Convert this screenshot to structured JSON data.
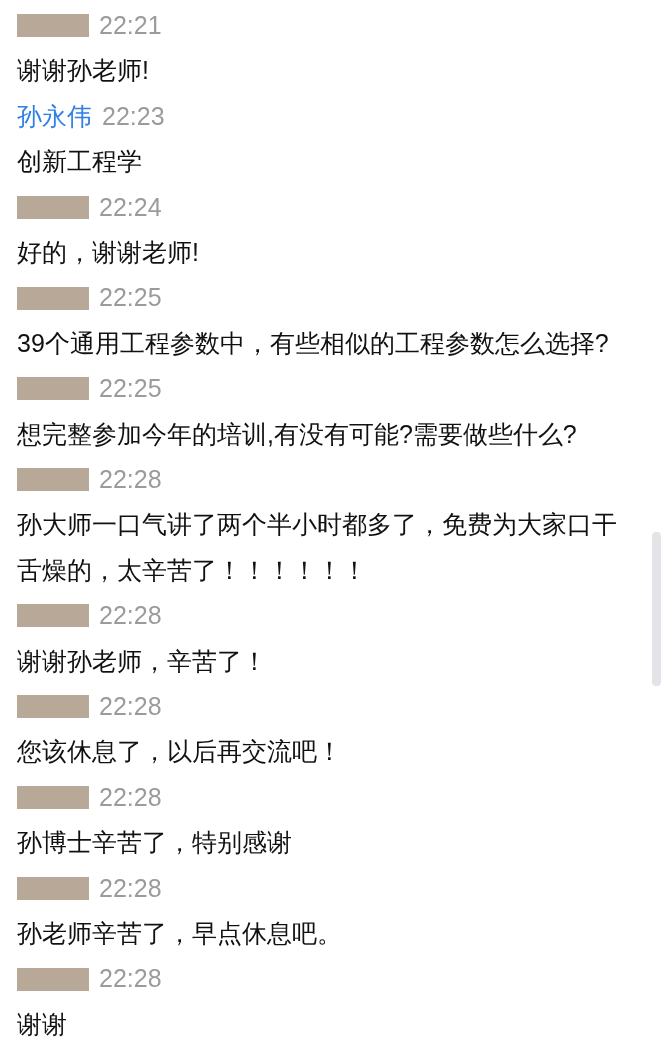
{
  "messages": [
    {
      "sender": {
        "kind": "redacted"
      },
      "time": "22:21",
      "text": "谢谢孙老师!"
    },
    {
      "sender": {
        "kind": "name",
        "name": "孙永伟",
        "color": "#2f7fe6"
      },
      "time": "22:23",
      "text": "创新工程学"
    },
    {
      "sender": {
        "kind": "redacted"
      },
      "time": "22:24",
      "text": "好的，谢谢老师!"
    },
    {
      "sender": {
        "kind": "redacted"
      },
      "time": "22:25",
      "text": "39个通用工程参数中，有些相似的工程参数怎么选择?"
    },
    {
      "sender": {
        "kind": "redacted"
      },
      "time": "22:25",
      "text": "想完整参加今年的培训,有没有可能?需要做些什么?"
    },
    {
      "sender": {
        "kind": "redacted"
      },
      "time": "22:28",
      "text": "孙大师一口气讲了两个半小时都多了，免费为大家口干舌燥的，太辛苦了！！！！！！"
    },
    {
      "sender": {
        "kind": "redacted"
      },
      "time": "22:28",
      "text": "谢谢孙老师，辛苦了！"
    },
    {
      "sender": {
        "kind": "redacted"
      },
      "time": "22:28",
      "text": "您该休息了，以后再交流吧！"
    },
    {
      "sender": {
        "kind": "redacted"
      },
      "time": "22:28",
      "text": "孙博士辛苦了，特别感谢"
    },
    {
      "sender": {
        "kind": "redacted"
      },
      "time": "22:28",
      "text": "孙老师辛苦了，早点休息吧。"
    },
    {
      "sender": {
        "kind": "redacted"
      },
      "time": "22:28",
      "text": "谢谢"
    }
  ]
}
